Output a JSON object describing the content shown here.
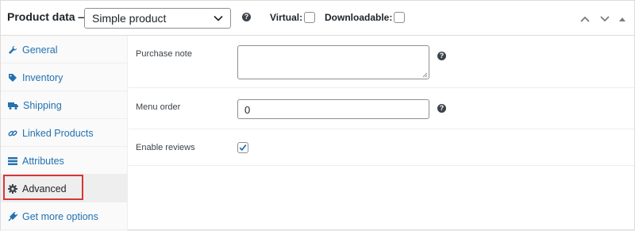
{
  "header": {
    "title": "Product data —",
    "product_type": "Simple product",
    "virtual_label": "Virtual:",
    "downloadable_label": "Downloadable:",
    "help_glyph": "?"
  },
  "sidebar": {
    "items": [
      {
        "label": "General",
        "icon": "wrench-icon"
      },
      {
        "label": "Inventory",
        "icon": "tag-icon"
      },
      {
        "label": "Shipping",
        "icon": "truck-icon"
      },
      {
        "label": "Linked Products",
        "icon": "link-icon"
      },
      {
        "label": "Attributes",
        "icon": "list-icon"
      },
      {
        "label": "Advanced",
        "icon": "gear-icon",
        "active": true
      },
      {
        "label": "Get more options",
        "icon": "plugin-icon"
      }
    ]
  },
  "fields": {
    "purchase_note": {
      "label": "Purchase note",
      "value": ""
    },
    "menu_order": {
      "label": "Menu order",
      "value": "0"
    },
    "enable_reviews": {
      "label": "Enable reviews",
      "checked": true
    }
  },
  "colors": {
    "link": "#2271b1",
    "checkmark": "#2271b1",
    "highlight": "#d63638"
  }
}
